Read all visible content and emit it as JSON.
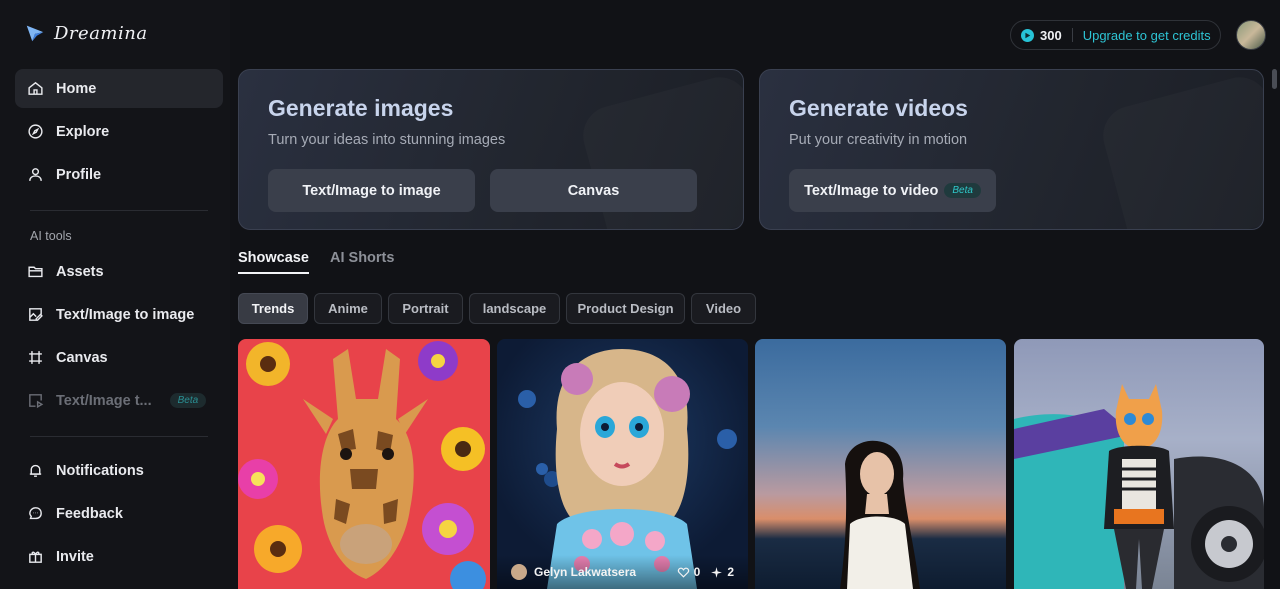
{
  "app": {
    "name": "Dreamina"
  },
  "sidebar": {
    "main_items": [
      {
        "label": "Home",
        "icon": "home-icon",
        "active": true
      },
      {
        "label": "Explore",
        "icon": "compass-icon"
      },
      {
        "label": "Profile",
        "icon": "user-icon"
      }
    ],
    "section_label": "AI tools",
    "tool_items": [
      {
        "label": "Assets",
        "icon": "folder-icon"
      },
      {
        "label": "Text/Image to image",
        "icon": "image-edit-icon"
      },
      {
        "label": "Canvas",
        "icon": "canvas-icon"
      },
      {
        "label": "Text/Image t...",
        "icon": "video-icon",
        "badge": "Beta",
        "disabled": true
      }
    ],
    "bottom_items": [
      {
        "label": "Notifications",
        "icon": "bell-icon"
      },
      {
        "label": "Feedback",
        "icon": "chat-icon"
      },
      {
        "label": "Invite",
        "icon": "gift-icon"
      }
    ]
  },
  "header": {
    "credits": "300",
    "upgrade_label": "Upgrade to get credits"
  },
  "hero": {
    "images": {
      "title": "Generate images",
      "subtitle": "Turn your ideas into stunning images",
      "buttons": [
        "Text/Image to image",
        "Canvas"
      ]
    },
    "videos": {
      "title": "Generate videos",
      "subtitle": "Put your creativity in motion",
      "button": "Text/Image to video",
      "badge": "Beta"
    }
  },
  "tabs": [
    "Showcase",
    "AI Shorts"
  ],
  "filters": [
    "Trends",
    "Anime",
    "Portrait",
    "landscape",
    "Product Design",
    "Video"
  ],
  "gallery": [
    {
      "subject": "giraffe-with-flowers"
    },
    {
      "subject": "doll-portrait",
      "author": "Gelyn Lakwatsera",
      "likes": "0",
      "remixes": "2"
    },
    {
      "subject": "woman-at-sunset-beach"
    },
    {
      "subject": "cat-with-car"
    }
  ],
  "colors": {
    "accent": "#2ec4d4",
    "background": "#111216",
    "sidebar": "#131418"
  }
}
